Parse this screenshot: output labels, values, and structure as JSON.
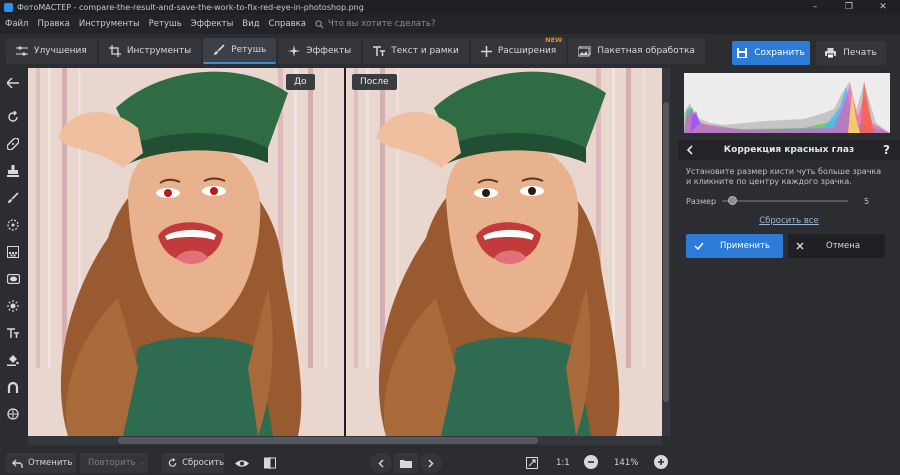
{
  "window": {
    "title": "ФотоМАСТЕР - compare-the-result-and-save-the-work-to-fix-red-eye-in-photoshop.png",
    "controls": [
      "–",
      "❐",
      "✕"
    ]
  },
  "menu": {
    "items": [
      "Файл",
      "Правка",
      "Инструменты",
      "Ретушь",
      "Эффекты",
      "Вид",
      "Справка"
    ],
    "search_placeholder": "Что вы хотите сделать?"
  },
  "tabs": [
    {
      "label": "Улучшения",
      "icon": "sliders-icon"
    },
    {
      "label": "Инструменты",
      "icon": "crop-icon"
    },
    {
      "label": "Ретушь",
      "icon": "brush-icon",
      "active": true
    },
    {
      "label": "Эффекты",
      "icon": "sparkle-icon"
    },
    {
      "label": "Текст и рамки",
      "icon": "text-icon"
    },
    {
      "label": "Расширения",
      "icon": "plus-icon",
      "badge": "NEW"
    },
    {
      "label": "Пакетная обработка",
      "icon": "batch-icon"
    }
  ],
  "actions": {
    "save": "Сохранить",
    "print": "Печать"
  },
  "compare": {
    "before": "До",
    "after": "После"
  },
  "panel": {
    "title": "Коррекция красных глаз",
    "help": "?",
    "hint": "Установите размер кисти чуть больше зрачка и кликните по центру каждого зрачка.",
    "size_label": "Размер",
    "size_value": "5",
    "size_fraction": 0.05,
    "reset_all": "Сбросить все",
    "apply": "Применить",
    "cancel": "Отмена"
  },
  "bottom": {
    "undo": "Отменить",
    "redo": "Повторить",
    "reset": "Сбросить",
    "zoom_fit": "1:1",
    "zoom_level": "141%"
  },
  "colors": {
    "accent": "#2c7bd6",
    "new_badge": "#f08a24"
  }
}
